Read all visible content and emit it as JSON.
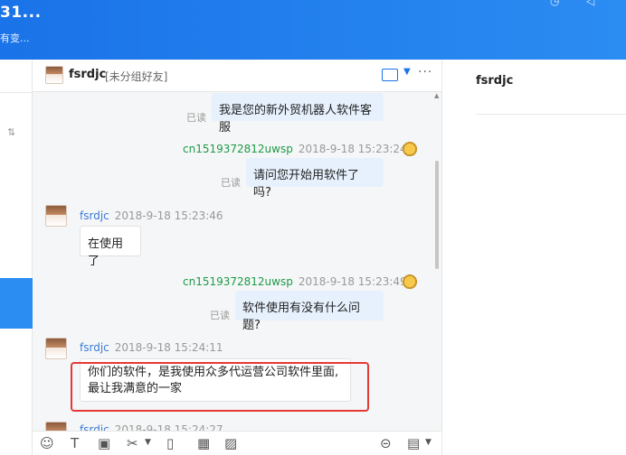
{
  "header": {
    "title": "31...",
    "subtitle": "有变..."
  },
  "chat": {
    "contact_name": "fsrdjc",
    "contact_tag": "[未分组好友]",
    "messages": [
      {
        "dir": "out",
        "read": "已读",
        "text": "我是您的新外贸机器人软件客服"
      },
      {
        "dir": "out",
        "user": "cn1519372812uwsp",
        "time": "2018-9-18 15:23:24",
        "read": "已读",
        "text": "请问您开始用软件了吗?"
      },
      {
        "dir": "in",
        "user": "fsrdjc",
        "time": "2018-9-18 15:23:46",
        "text": "在使用了"
      },
      {
        "dir": "out",
        "user": "cn1519372812uwsp",
        "time": "2018-9-18 15:23:49",
        "read": "已读",
        "text": "软件使用有没有什么问题?"
      },
      {
        "dir": "in",
        "user": "fsrdjc",
        "time": "2018-9-18 15:24:11",
        "text_line1": "你们的软件，是我使用众多代运营公司软件里面,",
        "text_line2": "最让我满意的一家"
      },
      {
        "dir": "in",
        "user": "fsrdjc",
        "time": "2018-9-18 15:24:27"
      }
    ]
  },
  "toolbar": {
    "icons": [
      "emoji-icon",
      "text-format-icon",
      "screenshot-icon",
      "scissors-icon",
      "dropdown-icon",
      "shake-icon",
      "table-icon",
      "image-icon",
      "history-icon",
      "quick-reply-icon",
      "dropdown-icon"
    ]
  },
  "right_panel": {
    "name": "fsrdjc"
  },
  "colors": {
    "header_blue": "#1a73e8",
    "bubble_out": "#e7f1fd",
    "sender_green": "#1e9a48",
    "receiver_blue": "#3a7bd5",
    "highlight_red": "#e53935"
  }
}
